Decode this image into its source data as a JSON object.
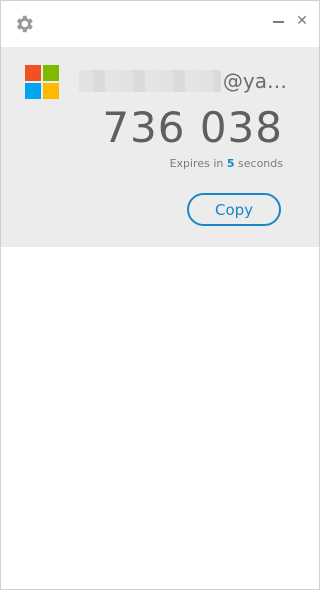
{
  "window": {
    "settings_icon": "gear-icon",
    "minimize_icon": "minimize-icon",
    "close_icon": "close-icon",
    "close_glyph": "✕"
  },
  "account": {
    "provider_icon": "microsoft-logo-icon",
    "name_suffix": "@ya…",
    "code": "736 038",
    "expires_prefix": "Expires in ",
    "expires_seconds": "5",
    "expires_suffix": " seconds",
    "copy_label": "Copy"
  },
  "colors": {
    "accent": "#1a86c8",
    "card_bg": "#ececec",
    "logo_red": "#f25022",
    "logo_green": "#7fba00",
    "logo_blue": "#00a4ef",
    "logo_yellow": "#ffb900"
  }
}
